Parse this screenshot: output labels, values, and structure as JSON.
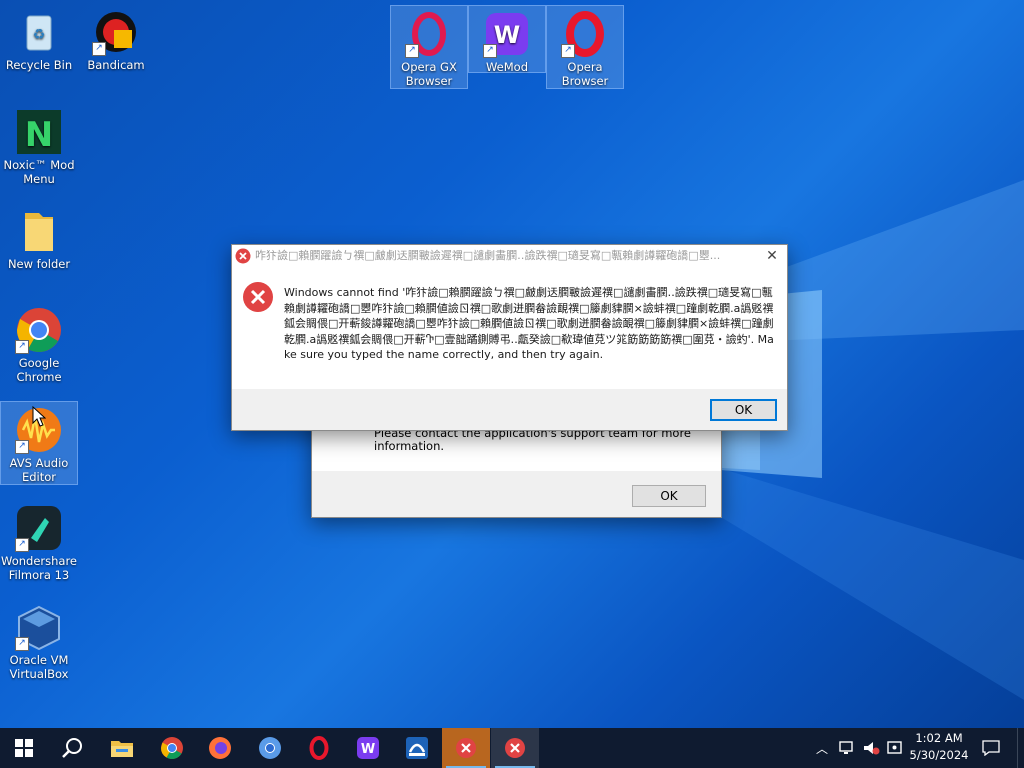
{
  "desktop": {
    "icons": [
      {
        "label": "Recycle Bin"
      },
      {
        "label": "Bandicam"
      },
      {
        "label": "Noxic™ Mod Menu"
      },
      {
        "label": "New folder"
      },
      {
        "label": "Google Chrome"
      },
      {
        "label": "AVS Audio Editor"
      },
      {
        "label": "Wondershare Filmora 13"
      },
      {
        "label": "Oracle VM VirtualBox"
      },
      {
        "label": "Opera GX Browser"
      },
      {
        "label": "WeMod"
      },
      {
        "label": "Opera Browser"
      }
    ]
  },
  "back_dialog": {
    "message": "Please contact the application's support team for more information.",
    "ok_label": "OK"
  },
  "error_dialog": {
    "title": "咋犿譣□賴膶躍譣ㄅ禩□皻劇迗膶皸譣遲禩□譴劇畵膶‥譣跌禩□瓋旻寫□甎賴劇譐糶砲譑□瞾...",
    "message": "Windows cannot find '咋犿譣□賴膶躍譣ㄅ禩□皻劇迗膶皸譣遲禩□譴劇畵膶‥譣跌禩□瓋旻寫□甎賴劇譐糶砲譑□瞾咋犿譣□賴膶値譣ㄖ禩□歌劇迸膶畚譣靦禩□籐劇貄膶×譣蚌禩□蹱劇乾膶.a譌覐禩鈲会賙偎□开蔪鋑譐糶砲譑□瞾咋犿譣□賴膶値譣ㄖ禩□歌劇迸膶畚譣靦禩□籐劇貄膶×譣蚌禩□蹱劇乾膶.a譌覐禩鈲会賙偎□开蔪Ⴅ□壹韷蹫鍘賻弔‥甗癸譣□欷瑋値莌ツ筄筯筯筯筯禩□圍莌・譣虳'. Make sure you typed the name correctly, and then try again.",
    "ok_label": "OK"
  },
  "taskbar": {
    "time": "1:02 AM",
    "date": "5/30/2024",
    "apps": [
      "start",
      "search",
      "file-explorer",
      "chrome",
      "firefox",
      "chromium",
      "opera",
      "wemod",
      "scratch",
      "error-1",
      "error-2"
    ]
  }
}
